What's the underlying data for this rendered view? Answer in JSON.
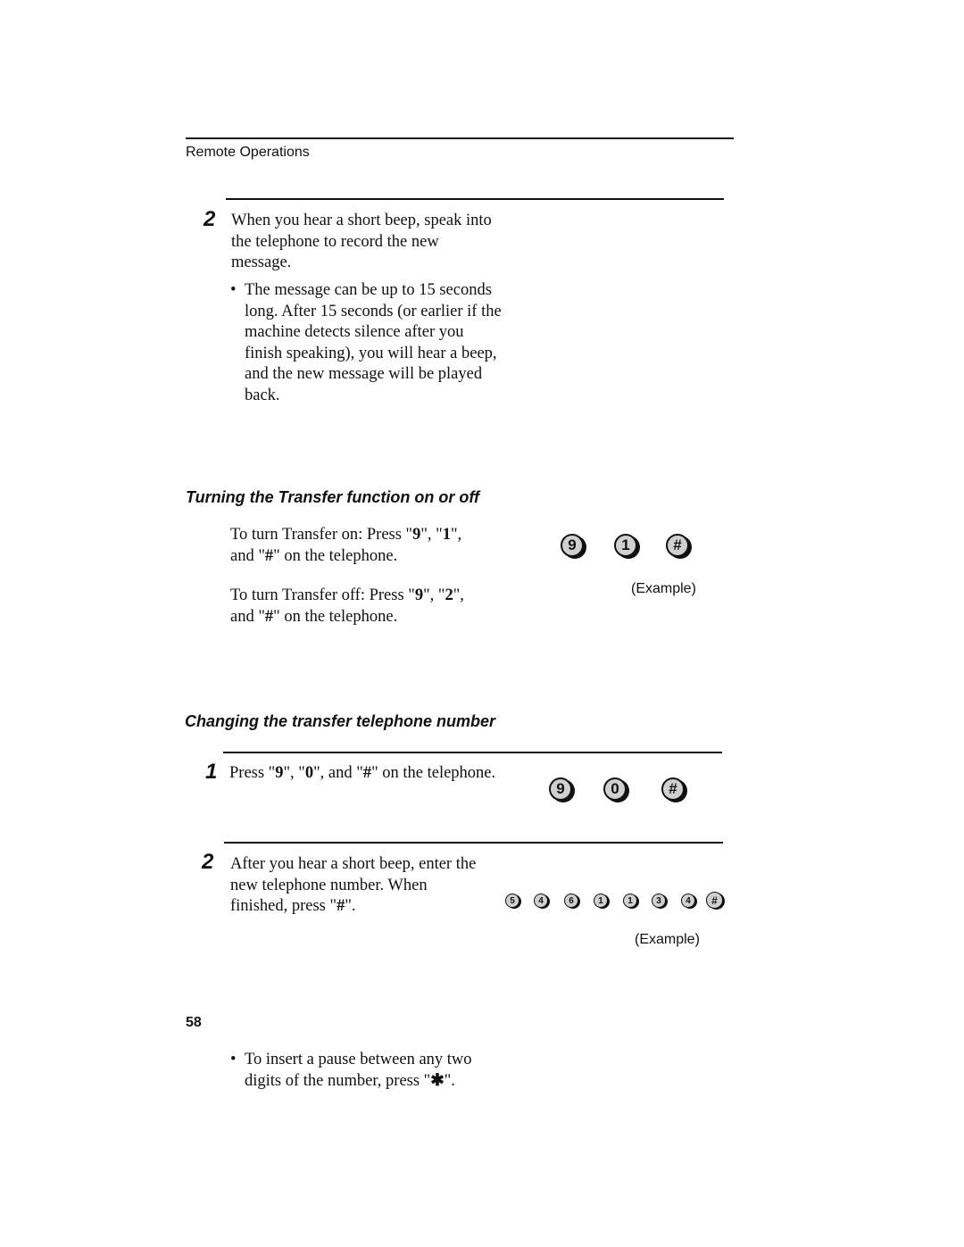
{
  "header": {
    "section_title": "Remote Operations"
  },
  "record_step": {
    "number": "2",
    "text": "When you hear a short beep, speak into the telephone to record the new message.",
    "bullet": "The message can be up to 15 seconds long. After 15 seconds (or earlier if the machine detects silence after you finish speaking), you will hear a beep, and the new message will be played back."
  },
  "transfer_section": {
    "heading": "Turning the Transfer function on or off",
    "on_text_a": "To turn Transfer on: Press \"",
    "on_key1": "9",
    "on_sep1": "\", \"",
    "on_key2": "1",
    "on_sep2": "\",",
    "on_line2_a": "and \"",
    "on_key3": "#",
    "on_line2_b": "\" on the telephone.",
    "off_text_a": "To turn Transfer off: Press \"",
    "off_key1": "9",
    "off_sep1": "\", \"",
    "off_key2": "2",
    "off_sep2": "\",",
    "off_line2_a": "and \"",
    "off_key3": "#",
    "off_line2_b": "\" on the telephone.",
    "keys": [
      "9",
      "1",
      "#"
    ],
    "example_label": "(Example)"
  },
  "change_section": {
    "heading": "Changing the transfer telephone number",
    "step1": {
      "number": "1",
      "text_a": "Press \"",
      "k1": "9",
      "sep1": "\", \"",
      "k2": "0",
      "sep2": "\", and \"",
      "k3": "#",
      "text_b": "\" on the telephone.",
      "keys": [
        "9",
        "0",
        "#"
      ]
    },
    "step2": {
      "number": "2",
      "line1": "After you hear a short beep, enter the",
      "line2": "new telephone number. When",
      "line3_a": "finished, press \"",
      "line3_key": "#",
      "line3_b": "\".",
      "bullet_line1": "To insert a pause between any two",
      "bullet_line2_a": "digits of the number, press \"",
      "bullet_key": "✱",
      "bullet_line2_b": "\".",
      "keys": [
        "5",
        "4",
        "6",
        "1",
        "1",
        "3",
        "4",
        "#"
      ],
      "example_label": "(Example)"
    }
  },
  "footer": {
    "page_number": "58"
  }
}
